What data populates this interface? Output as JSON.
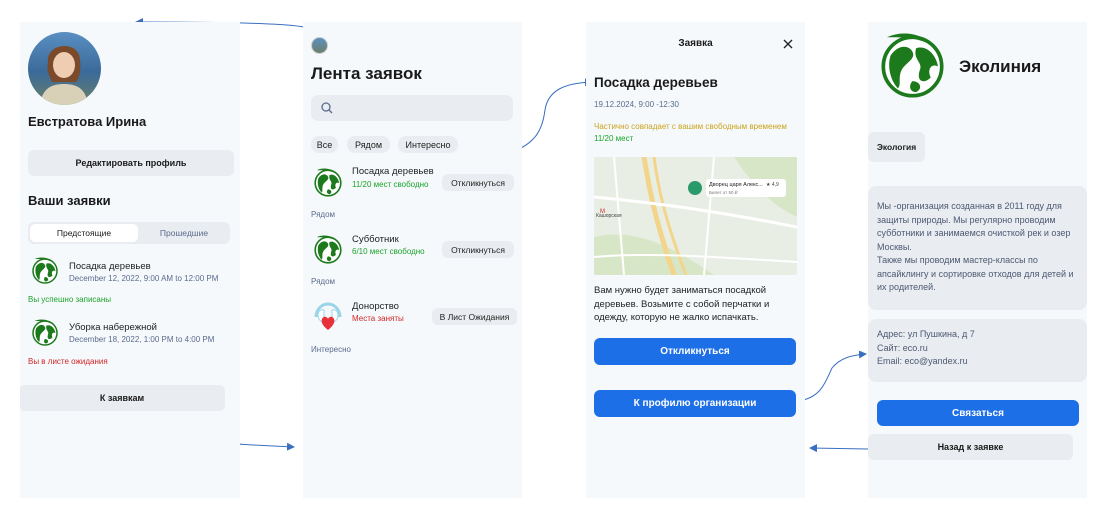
{
  "profile": {
    "name": "Евстратова Ирина",
    "edit_button": "Редактировать профиль",
    "section_title": "Ваши заявки",
    "tabs": [
      "Предстоящие",
      "Прошедшие"
    ],
    "items": [
      {
        "title": "Посадка деревьев",
        "date": "December 12, 2022, 9:00 AM to 12:00 PM",
        "status": "Вы успешно записаны"
      },
      {
        "title": "Уборка набережной",
        "date": "December 18, 2022, 1:00 PM to 4:00 PM",
        "status": "Вы в листе ожидания"
      }
    ],
    "to_requests_button": "К заявкам"
  },
  "feed": {
    "title": "Лента заявок",
    "search_placeholder": "",
    "filters": [
      "Все",
      "Рядом",
      "Интересно"
    ],
    "items": [
      {
        "title": "Посадка деревьев",
        "status": "11/20 мест свободно",
        "action": "Откликнуться",
        "tag": "Рядом"
      },
      {
        "title": "Субботник",
        "status": "6/10 мест свободно",
        "action": "Откликнуться",
        "tag": "Рядом"
      },
      {
        "title": "Донорство",
        "status": "Места заняты",
        "action": "В Лист Ожидания",
        "tag": "Интересно"
      }
    ]
  },
  "detail": {
    "header": "Заявка",
    "title": "Посадка деревьев",
    "datetime": "19.12.2024, 9:00 -12:30",
    "match": "Частично совпадает с вашим свободным временем",
    "seats": "11/20 мест",
    "map_label": "Дворец царя Алекс...",
    "map_sublabel": "Билет от 50 ₽",
    "map_rating": "★ 4,9",
    "map_metro": "Кашорская",
    "description": "Вам нужно будет заниматься посадкой деревьев. Возьмите с собой перчатки и одежду, которую не жалко испачкать.",
    "respond_button": "Откликнуться",
    "org_button": "К профилю организации"
  },
  "org": {
    "name": "Эколиния",
    "tag": "Экология",
    "about": "Мы -организация созданная в 2011 году для защиты природы. Мы регулярно проводим субботники и занимаемся очисткой рек и озер Москвы.\nТакже мы проводим мастер-классы по апсайклингу и сортировке отходов для детей и их родителей.",
    "address": "Адрес: ул Пушкина, д 7",
    "site": "Сайт: eco.ru",
    "email": "Email: eco@yandex.ru",
    "contact_button": "Связаться",
    "back_button": "Назад к заявке"
  },
  "colors": {
    "accent": "#1c6fe6",
    "arrow": "#3a6fc0",
    "success": "#1aa32a",
    "danger": "#d02626",
    "warning": "#c9a31c"
  }
}
